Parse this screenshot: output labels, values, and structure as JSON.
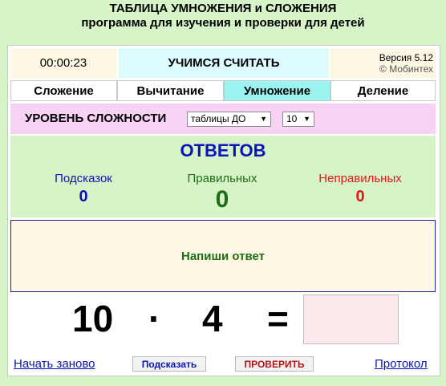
{
  "header": {
    "title_line1": "ТАБЛИЦА УМНОЖЕНИЯ и СЛОЖЕНИЯ",
    "title_line2": "программа для изучения и проверки для детей"
  },
  "top_bar": {
    "timer": "00:00:23",
    "brand": "УЧИМСЯ СЧИТАТЬ",
    "version": "Версия 5.12",
    "copyright": "© Мобинтех"
  },
  "tabs": [
    {
      "label": "Сложение",
      "active": false
    },
    {
      "label": "Вычитание",
      "active": false
    },
    {
      "label": "Умножение",
      "active": true
    },
    {
      "label": "Деление",
      "active": false
    }
  ],
  "level": {
    "label": "УРОВЕНЬ СЛОЖНОСТИ",
    "mode_value": "таблицы ДО",
    "limit_value": "10"
  },
  "answers": {
    "title": "ОТВЕТОВ",
    "hints_label": "Подсказок",
    "hints_value": "0",
    "correct_label": "Правильных",
    "correct_value": "0",
    "wrong_label": "Неправильных",
    "wrong_value": "0"
  },
  "prompt": "Напиши ответ",
  "problem": {
    "a": "10",
    "op": "·",
    "b": "4",
    "eq": "=",
    "answer": ""
  },
  "footer": {
    "restart": "Начать заново",
    "hint": "Подсказать",
    "check": "ПРОВЕРИТЬ",
    "log": "Протокол"
  },
  "colors": {
    "page_bg": "#d7f3c8",
    "tab_active": "#9cf4f1",
    "level_bg": "#f7d2f4",
    "blue": "#0b14b8",
    "green": "#1f6d17",
    "red": "#e01818",
    "answer_box": "#fde9ec"
  }
}
